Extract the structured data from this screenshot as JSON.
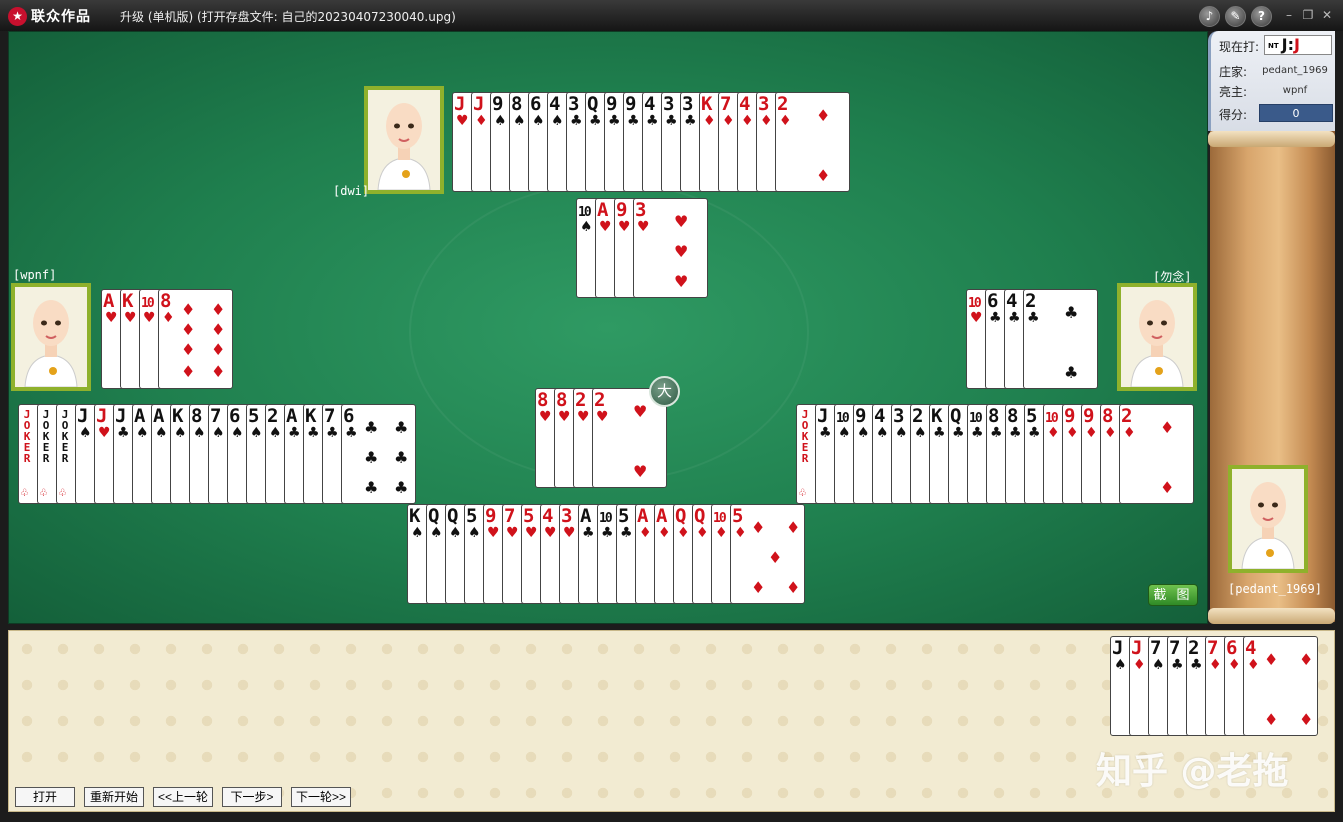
{
  "app": {
    "logo": "联众作品",
    "title": "升级 (单机版) (打开存盘文件: 自己的20230407230040.upg)",
    "help_glyph": "?"
  },
  "info": {
    "current_label": "现在打:",
    "trump_nt": "NT",
    "trump_left": "J",
    "trump_sep": ":",
    "trump_right": "J",
    "dealer_label": "庄家:",
    "dealer": "pedant_1969",
    "declarer_label": "亮主:",
    "declarer": "wpnf",
    "score_label": "得分:",
    "score": "0"
  },
  "players": {
    "north": "[dwi]",
    "west": "[wpnf]",
    "east": "[勿念]",
    "south": "[pedant_1969]"
  },
  "badge": "大",
  "screenshot_button": "截 图",
  "watermark": "知乎 @老拖",
  "controls": [
    "打开",
    "重新开始",
    "<<上一轮",
    "下一步>",
    "下一轮>>"
  ],
  "hands": {
    "north": [
      {
        "r": "J",
        "s": "♥"
      },
      {
        "r": "J",
        "s": "♦"
      },
      {
        "r": "9",
        "s": "♠"
      },
      {
        "r": "8",
        "s": "♠"
      },
      {
        "r": "6",
        "s": "♠"
      },
      {
        "r": "4",
        "s": "♠"
      },
      {
        "r": "3",
        "s": "♣"
      },
      {
        "r": "Q",
        "s": "♣"
      },
      {
        "r": "9",
        "s": "♣"
      },
      {
        "r": "9",
        "s": "♣"
      },
      {
        "r": "4",
        "s": "♣"
      },
      {
        "r": "3",
        "s": "♣"
      },
      {
        "r": "3",
        "s": "♣"
      },
      {
        "r": "K",
        "s": "♦"
      },
      {
        "r": "7",
        "s": "♦"
      },
      {
        "r": "4",
        "s": "♦"
      },
      {
        "r": "3",
        "s": "♦"
      },
      {
        "r": "2",
        "s": "♦"
      }
    ],
    "north_play": [
      {
        "r": "10",
        "s": "♠"
      },
      {
        "r": "A",
        "s": "♥"
      },
      {
        "r": "9",
        "s": "♥"
      },
      {
        "r": "3",
        "s": "♥"
      }
    ],
    "west_play": [
      {
        "r": "A",
        "s": "♥"
      },
      {
        "r": "K",
        "s": "♥"
      },
      {
        "r": "10",
        "s": "♥"
      },
      {
        "r": "8",
        "s": "♦"
      }
    ],
    "east_play": [
      {
        "r": "10",
        "s": "♥"
      },
      {
        "r": "6",
        "s": "♣"
      },
      {
        "r": "4",
        "s": "♣"
      },
      {
        "r": "2",
        "s": "♣"
      }
    ],
    "center_play": [
      {
        "r": "8",
        "s": "♥"
      },
      {
        "r": "8",
        "s": "♥"
      },
      {
        "r": "2",
        "s": "♥"
      },
      {
        "r": "2",
        "s": "♥"
      }
    ],
    "west": [
      {
        "r": "JOKER",
        "s": "red"
      },
      {
        "r": "JOKER",
        "s": "black"
      },
      {
        "r": "JOKER",
        "s": "black"
      },
      {
        "r": "J",
        "s": "♠"
      },
      {
        "r": "J",
        "s": "♥"
      },
      {
        "r": "J",
        "s": "♣"
      },
      {
        "r": "A",
        "s": "♠"
      },
      {
        "r": "A",
        "s": "♠"
      },
      {
        "r": "K",
        "s": "♠"
      },
      {
        "r": "8",
        "s": "♠"
      },
      {
        "r": "7",
        "s": "♠"
      },
      {
        "r": "6",
        "s": "♠"
      },
      {
        "r": "5",
        "s": "♠"
      },
      {
        "r": "2",
        "s": "♠"
      },
      {
        "r": "A",
        "s": "♣"
      },
      {
        "r": "K",
        "s": "♣"
      },
      {
        "r": "7",
        "s": "♣"
      },
      {
        "r": "6",
        "s": "♣"
      }
    ],
    "east": [
      {
        "r": "JOKER",
        "s": "red"
      },
      {
        "r": "J",
        "s": "♣"
      },
      {
        "r": "10",
        "s": "♠"
      },
      {
        "r": "9",
        "s": "♠"
      },
      {
        "r": "4",
        "s": "♠"
      },
      {
        "r": "3",
        "s": "♠"
      },
      {
        "r": "2",
        "s": "♠"
      },
      {
        "r": "K",
        "s": "♣"
      },
      {
        "r": "Q",
        "s": "♣"
      },
      {
        "r": "10",
        "s": "♣"
      },
      {
        "r": "8",
        "s": "♣"
      },
      {
        "r": "8",
        "s": "♣"
      },
      {
        "r": "5",
        "s": "♣"
      },
      {
        "r": "10",
        "s": "♦"
      },
      {
        "r": "9",
        "s": "♦"
      },
      {
        "r": "9",
        "s": "♦"
      },
      {
        "r": "8",
        "s": "♦"
      },
      {
        "r": "2",
        "s": "♦"
      }
    ],
    "south": [
      {
        "r": "K",
        "s": "♠"
      },
      {
        "r": "Q",
        "s": "♠"
      },
      {
        "r": "Q",
        "s": "♠"
      },
      {
        "r": "5",
        "s": "♠"
      },
      {
        "r": "9",
        "s": "♥"
      },
      {
        "r": "7",
        "s": "♥"
      },
      {
        "r": "5",
        "s": "♥"
      },
      {
        "r": "4",
        "s": "♥"
      },
      {
        "r": "3",
        "s": "♥"
      },
      {
        "r": "A",
        "s": "♣"
      },
      {
        "r": "10",
        "s": "♣"
      },
      {
        "r": "5",
        "s": "♣"
      },
      {
        "r": "A",
        "s": "♦"
      },
      {
        "r": "A",
        "s": "♦"
      },
      {
        "r": "Q",
        "s": "♦"
      },
      {
        "r": "Q",
        "s": "♦"
      },
      {
        "r": "10",
        "s": "♦"
      },
      {
        "r": "5",
        "s": "♦"
      }
    ],
    "kitty": [
      {
        "r": "J",
        "s": "♠"
      },
      {
        "r": "J",
        "s": "♦"
      },
      {
        "r": "7",
        "s": "♠"
      },
      {
        "r": "7",
        "s": "♣"
      },
      {
        "r": "2",
        "s": "♣"
      },
      {
        "r": "7",
        "s": "♦"
      },
      {
        "r": "6",
        "s": "♦"
      },
      {
        "r": "4",
        "s": "♦"
      }
    ]
  }
}
